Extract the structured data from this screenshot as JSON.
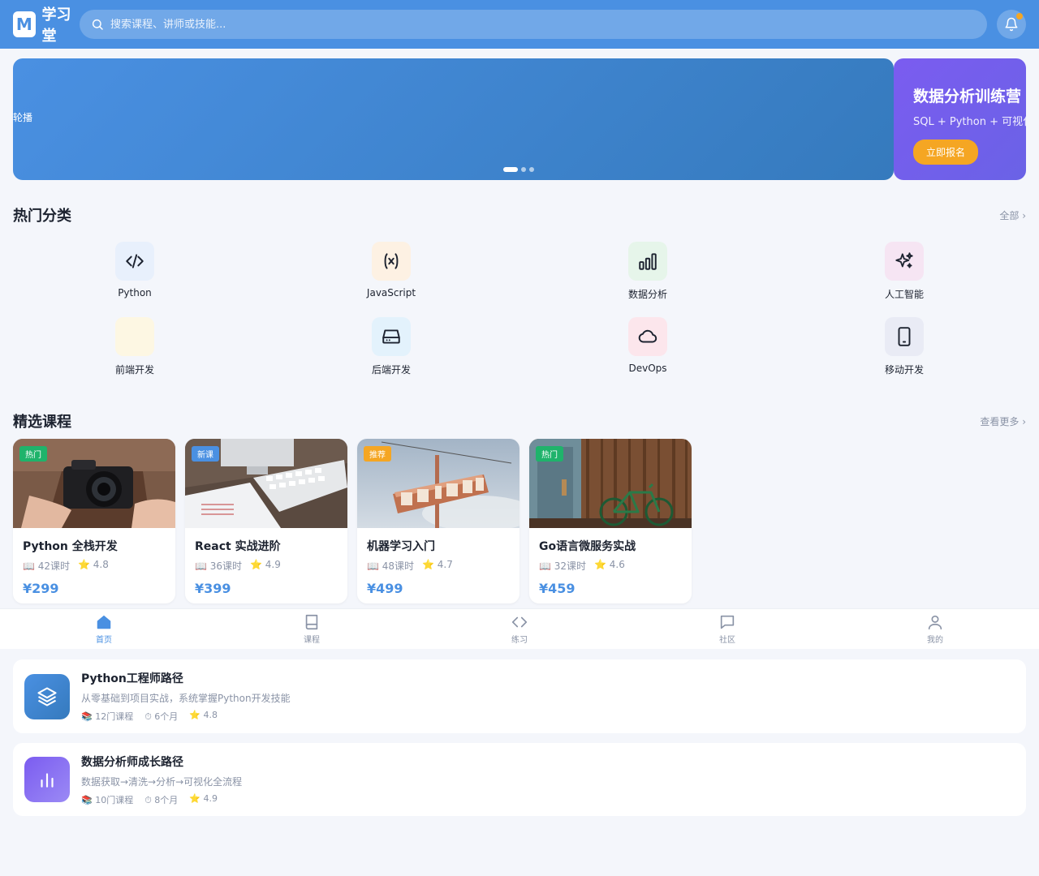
{
  "header": {
    "logo_letter": "M",
    "logo_text": "学习堂",
    "search_placeholder": "搜索课程、讲师或技能..."
  },
  "banner": {
    "text": "轮播",
    "slide_count": 3,
    "active_slide": 1
  },
  "promo": {
    "title": "数据分析训练营",
    "subtitle": "SQL + Python + 可视化实战",
    "button": "立即报名"
  },
  "categories": {
    "title": "热门分类",
    "more": "全部 ›",
    "items": [
      {
        "label": "Python",
        "icon": "code-icon",
        "bg": "#e8f0fc"
      },
      {
        "label": "JavaScript",
        "icon": "variable-icon",
        "bg": "#fdf1e3"
      },
      {
        "label": "数据分析",
        "icon": "chart-bars-icon",
        "bg": "#e6f5ea"
      },
      {
        "label": "人工智能",
        "icon": "sparkles-icon",
        "bg": "#f6e5f3"
      },
      {
        "label": "前端开发",
        "icon": "blank-icon",
        "bg": "#fdf7e3"
      },
      {
        "label": "后端开发",
        "icon": "server-icon",
        "bg": "#e3f2fc"
      },
      {
        "label": "DevOps",
        "icon": "cloud-icon",
        "bg": "#fce6ec"
      },
      {
        "label": "移动开发",
        "icon": "phone-icon",
        "bg": "#e9ebf5"
      }
    ]
  },
  "courses": {
    "title": "精选课程",
    "more": "查看更多 ›",
    "items": [
      {
        "tag": "热门",
        "tag_color": "#1fb36b",
        "name": "Python 全栈开发",
        "lessons": "📖 42课时",
        "rating": "⭐ 4.8",
        "price": "¥299",
        "image": "camera-photo"
      },
      {
        "tag": "新课",
        "tag_color": "#4a90e2",
        "name": "React 实战进阶",
        "lessons": "📖 36课时",
        "rating": "⭐ 4.9",
        "price": "¥399",
        "image": "keyboard-photo"
      },
      {
        "tag": "推荐",
        "tag_color": "#f5a623",
        "name": "机器学习入门",
        "lessons": "📖 48课时",
        "rating": "⭐ 4.7",
        "price": "¥499",
        "image": "motel-sign-photo"
      },
      {
        "tag": "热门",
        "tag_color": "#1fb36b",
        "name": "Go语言微服务实战",
        "lessons": "📖 32课时",
        "rating": "⭐ 4.6",
        "price": "¥459",
        "image": "bicycle-photo"
      }
    ]
  },
  "tabbar": {
    "items": [
      {
        "label": "首页",
        "icon": "home-icon",
        "active": true
      },
      {
        "label": "课程",
        "icon": "book-icon",
        "active": false
      },
      {
        "label": "练习",
        "icon": "code-icon",
        "active": false
      },
      {
        "label": "社区",
        "icon": "chat-icon",
        "active": false
      },
      {
        "label": "我的",
        "icon": "user-icon",
        "active": false
      }
    ]
  },
  "paths": {
    "items": [
      {
        "title": "Python工程师路径",
        "desc": "从零基础到项目实战，系统掌握Python开发技能",
        "courses": "📚 12门课程",
        "duration": "⏱ 6个月",
        "rating": "⭐ 4.8",
        "icon": "layers-icon",
        "gradient": [
          "#4a90e2",
          "#357abd"
        ]
      },
      {
        "title": "数据分析师成长路径",
        "desc": "数据获取→清洗→分析→可视化全流程",
        "courses": "📚 10门课程",
        "duration": "⏱ 8个月",
        "rating": "⭐ 4.9",
        "icon": "bar-chart-icon",
        "gradient": [
          "#7b5cf0",
          "#9b8af5"
        ]
      }
    ]
  }
}
